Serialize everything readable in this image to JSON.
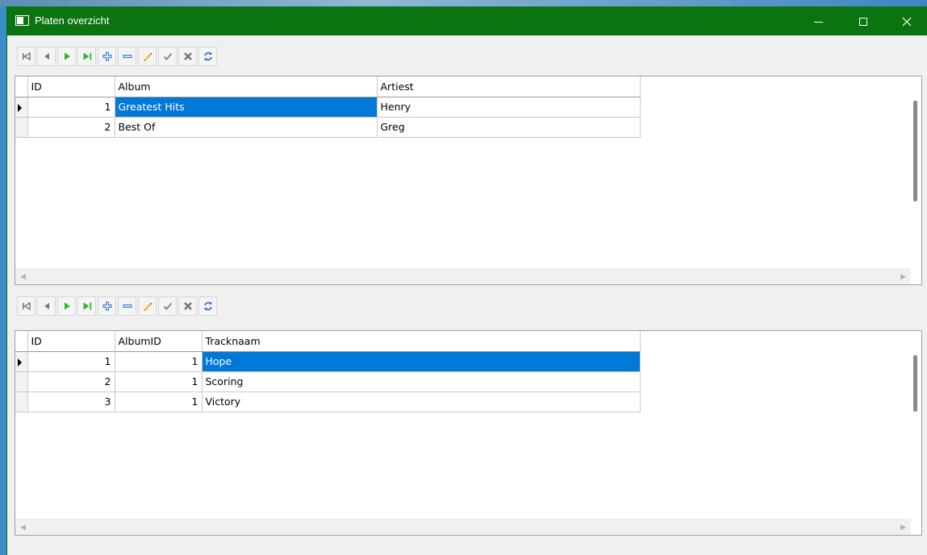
{
  "window": {
    "title": "Platen overzicht",
    "titlebar_color": "#0b7410"
  },
  "navigator": {
    "buttons": [
      {
        "name": "first-record-icon"
      },
      {
        "name": "prior-record-icon"
      },
      {
        "name": "next-record-icon"
      },
      {
        "name": "last-record-icon"
      },
      {
        "name": "insert-record-icon"
      },
      {
        "name": "delete-record-icon"
      },
      {
        "name": "edit-record-icon"
      },
      {
        "name": "post-record-icon"
      },
      {
        "name": "cancel-record-icon"
      },
      {
        "name": "refresh-icon"
      }
    ]
  },
  "albums_grid": {
    "columns": [
      "ID",
      "Album",
      "Artiest"
    ],
    "rows": [
      {
        "id": "1",
        "album": "Greatest Hits",
        "artiest": "Henry"
      },
      {
        "id": "2",
        "album": "Best Of",
        "artiest": "Greg"
      }
    ],
    "selected_row": 0
  },
  "tracks_grid": {
    "columns": [
      "ID",
      "AlbumID",
      "Tracknaam"
    ],
    "rows": [
      {
        "id": "1",
        "albumid": "1",
        "tracknaam": "Hope"
      },
      {
        "id": "2",
        "albumid": "1",
        "tracknaam": "Scoring"
      },
      {
        "id": "3",
        "albumid": "1",
        "tracknaam": "Victory"
      }
    ],
    "selected_row": 0
  },
  "colors": {
    "selection": "#0078d7",
    "nav_green": "#2fb52f",
    "nav_blue": "#3a78d0"
  }
}
